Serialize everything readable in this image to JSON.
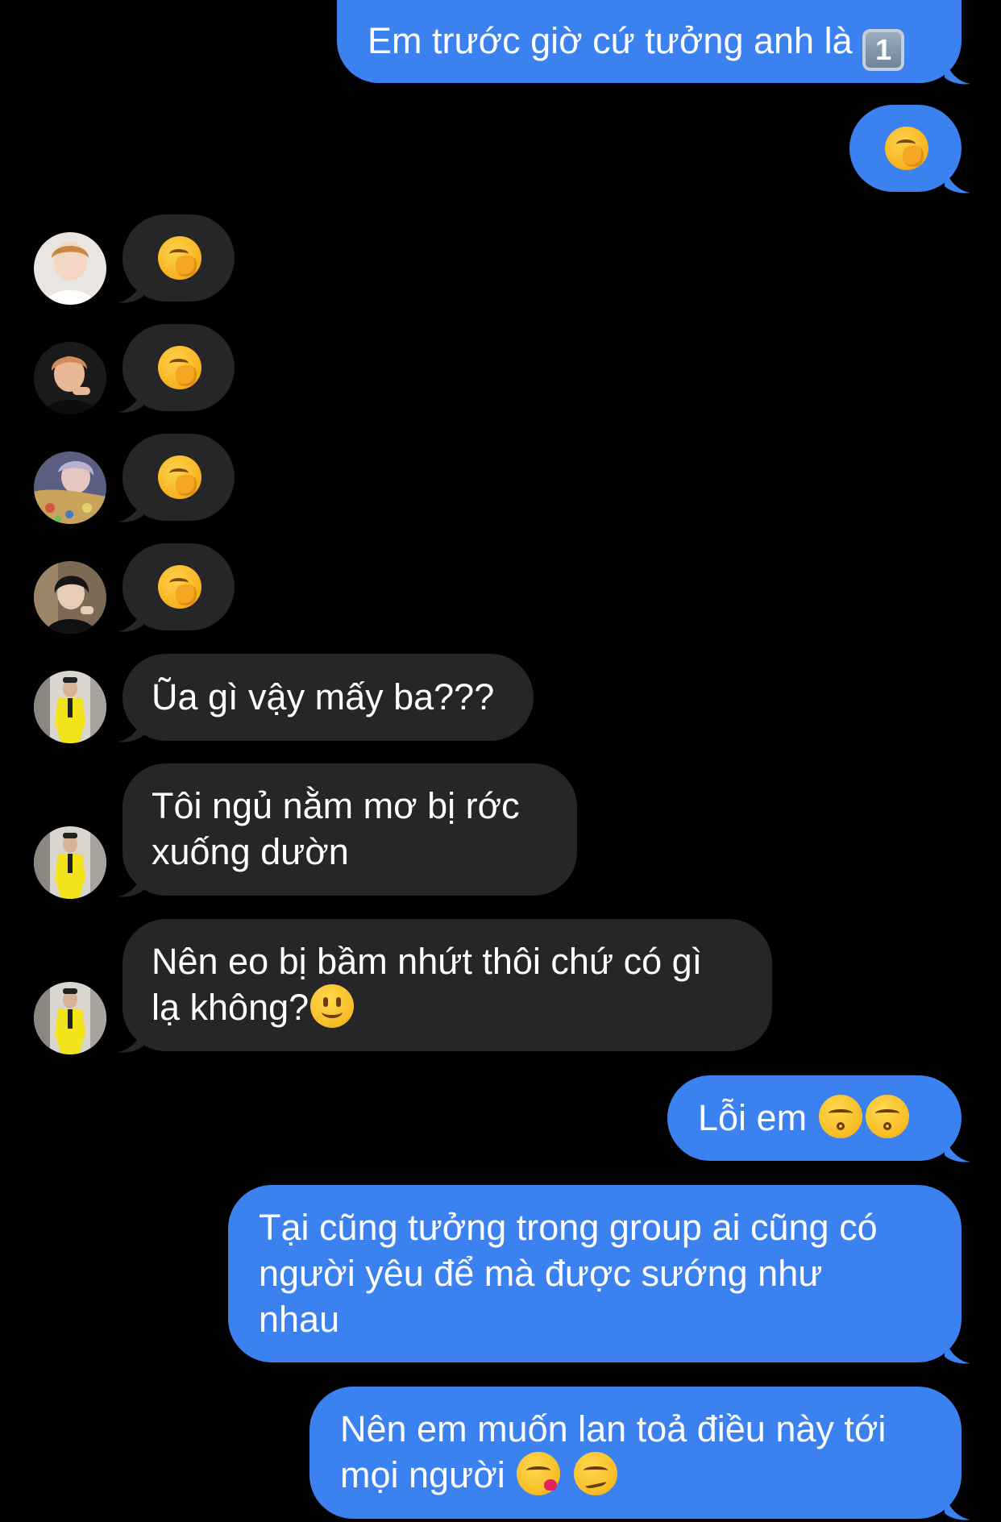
{
  "colors": {
    "background": "#000000",
    "outgoing_bubble": "#3b82f0",
    "incoming_bubble": "#262628",
    "text": "#ffffff"
  },
  "messages": [
    {
      "direction": "outgoing",
      "text": "Em trước giờ cứ tưởng anh là",
      "emoji": [
        "keycap-1"
      ],
      "keycap_text": "1"
    },
    {
      "direction": "outgoing",
      "text": "",
      "emoji": [
        "hand-over-mouth-icon"
      ]
    },
    {
      "direction": "incoming",
      "sender_avatar": "avatar-1",
      "text": "",
      "emoji": [
        "hand-over-mouth-icon"
      ]
    },
    {
      "direction": "incoming",
      "sender_avatar": "avatar-2",
      "text": "",
      "emoji": [
        "hand-over-mouth-icon"
      ]
    },
    {
      "direction": "incoming",
      "sender_avatar": "avatar-3",
      "text": "",
      "emoji": [
        "hand-over-mouth-icon"
      ]
    },
    {
      "direction": "incoming",
      "sender_avatar": "avatar-4",
      "text": "",
      "emoji": [
        "hand-over-mouth-icon"
      ]
    },
    {
      "direction": "incoming",
      "sender_avatar": "avatar-5",
      "text": "Ũa gì vậy mấy ba???"
    },
    {
      "direction": "incoming",
      "sender_avatar": "avatar-5",
      "text": "Tôi ngủ nằm mơ bị rớc\nxuống dườn"
    },
    {
      "direction": "incoming",
      "sender_avatar": "avatar-5",
      "text": "Nên eo bị bầm nhứt thôi chứ có gì\nlạ không?",
      "emoji": [
        "slight-smile-icon"
      ]
    },
    {
      "direction": "outgoing",
      "text": "Lỗi em",
      "emoji": [
        "kissing-closed-eyes-icon",
        "kissing-closed-eyes-icon"
      ]
    },
    {
      "direction": "outgoing",
      "text": "Tại cũng tưởng trong group ai cũng có\nngười yêu để mà được sướng như\nnhau"
    },
    {
      "direction": "outgoing",
      "text": "Nên em muốn lan toả điều này tới\nmọi người",
      "emoji": [
        "face-blowing-kiss-icon",
        "woozy-face-icon"
      ]
    }
  ]
}
